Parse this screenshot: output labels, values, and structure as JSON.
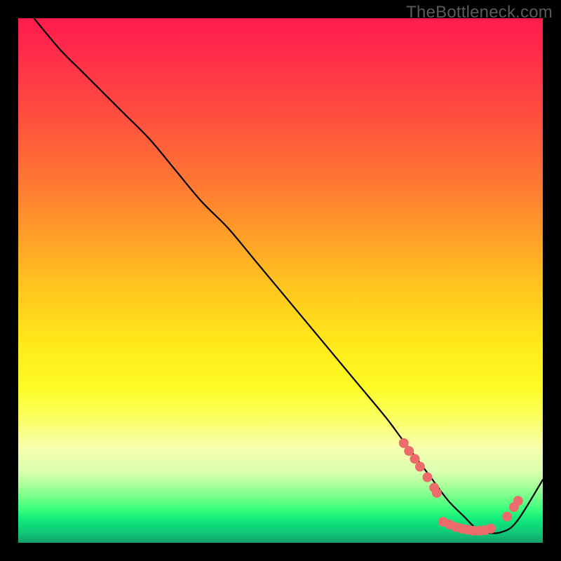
{
  "watermark": "TheBottleneck.com",
  "chart_data": {
    "type": "line",
    "title": "",
    "xlabel": "",
    "ylabel": "",
    "xlim": [
      0,
      100
    ],
    "ylim": [
      0,
      100
    ],
    "series": [
      {
        "name": "bottleneck-curve",
        "x": [
          3,
          8,
          12,
          16,
          20,
          25,
          30,
          35,
          40,
          45,
          50,
          55,
          60,
          65,
          70,
          73,
          76,
          79,
          82,
          85,
          87,
          89,
          92,
          95,
          100
        ],
        "y": [
          100,
          94,
          90,
          86,
          82,
          77,
          71,
          65,
          60,
          54,
          48,
          42,
          36,
          30,
          24,
          20,
          16,
          12,
          8,
          5,
          3,
          2,
          2,
          4,
          12
        ]
      }
    ],
    "markers": [
      {
        "name": "highlight-dots",
        "color": "#ed6b6a",
        "points": [
          {
            "x": 73.5,
            "y": 19
          },
          {
            "x": 74.5,
            "y": 17.5
          },
          {
            "x": 75.6,
            "y": 16
          },
          {
            "x": 76.6,
            "y": 14.5
          },
          {
            "x": 78.0,
            "y": 12.5
          },
          {
            "x": 79.3,
            "y": 10.5
          },
          {
            "x": 79.8,
            "y": 9.5
          },
          {
            "x": 81.0,
            "y": 4.0
          },
          {
            "x": 82.2,
            "y": 3.5
          },
          {
            "x": 83.4,
            "y": 3.0
          },
          {
            "x": 84.5,
            "y": 2.7
          },
          {
            "x": 85.6,
            "y": 2.5
          },
          {
            "x": 86.7,
            "y": 2.3
          },
          {
            "x": 87.9,
            "y": 2.3
          },
          {
            "x": 89.0,
            "y": 2.4
          },
          {
            "x": 90.1,
            "y": 2.7
          },
          {
            "x": 93.2,
            "y": 5.0
          },
          {
            "x": 94.5,
            "y": 6.8
          },
          {
            "x": 95.3,
            "y": 8.0
          }
        ]
      }
    ],
    "gradient_stops": [
      {
        "pos": 0.0,
        "color": "#ff1c4d"
      },
      {
        "pos": 0.32,
        "color": "#ff7a32"
      },
      {
        "pos": 0.62,
        "color": "#ffe91a"
      },
      {
        "pos": 0.82,
        "color": "#f7ffb0"
      },
      {
        "pos": 0.92,
        "color": "#6fff88"
      },
      {
        "pos": 1.0,
        "color": "#12a06a"
      }
    ],
    "grid": false,
    "legend": false
  }
}
